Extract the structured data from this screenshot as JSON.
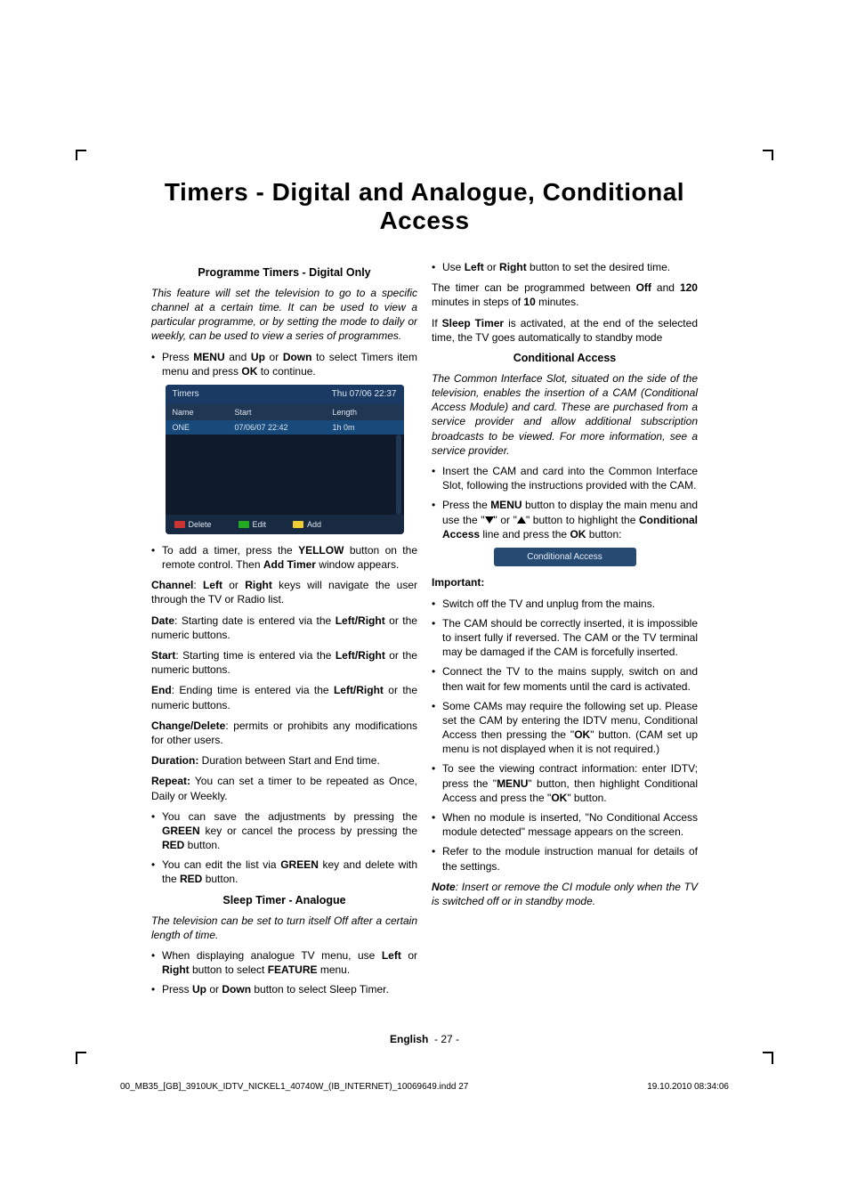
{
  "title": "Timers - Digital and Analogue, Conditional Access",
  "sections": {
    "prog_timers_head": "Programme Timers - Digital Only",
    "sleep_timer_head": "Sleep Timer - Analogue",
    "cond_access_head": "Conditional Access"
  },
  "left": {
    "intro": "This feature will set the television to go to a specific channel at a certain time. It can be used to view a particular programme, or by setting the mode to daily or weekly, can be used to view a series of programmes.",
    "li_menu_pre": "Press ",
    "li_menu_b1": "MENU",
    "li_menu_mid1": " and ",
    "li_menu_b2": "Up",
    "li_menu_mid2": " or ",
    "li_menu_b3": "Down",
    "li_menu_mid3": " to select Timers item menu and press ",
    "li_menu_b4": "OK",
    "li_menu_post": " to continue.",
    "add_pre": "To add a timer, press the ",
    "add_b1": "YELLOW",
    "add_mid": " button on the remote control. Then ",
    "add_b2": "Add Timer",
    "add_post": " window appears.",
    "channel_lbl": "Channel",
    "channel_sep": ": ",
    "channel_b1": "Left",
    "channel_mid": " or ",
    "channel_b2": "Right",
    "channel_txt": " keys will navigate the user through the TV or Radio list.",
    "date_lbl": "Date",
    "date_txt_pre": ": Starting date is entered via the ",
    "date_b": "Left/Right",
    "date_txt_post": " or the numeric buttons.",
    "start_lbl": "Start",
    "start_txt_pre": ": Starting time is entered via the ",
    "start_b": "Left/Right",
    "start_txt_post": " or the numeric buttons.",
    "end_lbl": "End",
    "end_txt_pre": ": Ending time is entered via the ",
    "end_b": "Left/Right",
    "end_txt_post": " or the numeric buttons.",
    "cd_lbl": "Change/Delete",
    "cd_txt": ": permits or prohibits any modifications for other users.",
    "dur_lbl": "Duration:",
    "dur_txt": " Duration between Start and End time.",
    "rep_lbl": "Repeat:",
    "rep_txt": " You can set a timer to be repeated as Once, Daily or Weekly.",
    "save_pre": "You can save the adjustments by pressing the ",
    "save_b1": "GREEN",
    "save_mid": " key or cancel the process by pressing the ",
    "save_b2": "RED",
    "save_post": " button.",
    "edit_pre": "You can edit the list via ",
    "edit_b1": "GREEN",
    "edit_mid": " key and delete with the ",
    "edit_b2": "RED",
    "edit_post": " button.",
    "sleep_intro": "The television can be set to turn itself Off after a certain length of time.",
    "sleep_li1_pre": "When displaying analogue TV menu, use ",
    "sleep_li1_b1": "Left",
    "sleep_li1_mid": " or ",
    "sleep_li1_b2": "Right",
    "sleep_li1_mid2": " button to select ",
    "sleep_li1_b3": "FEATURE",
    "sleep_li1_post": " menu.",
    "sleep_li2_pre": "Press ",
    "sleep_li2_b1": "Up",
    "sleep_li2_mid": " or ",
    "sleep_li2_b2": "Down",
    "sleep_li2_post": " button to select Sleep Timer."
  },
  "timers_ui": {
    "title": "Timers",
    "clock": "Thu 07/06 22:37",
    "h_name": "Name",
    "h_start": "Start",
    "h_length": "Length",
    "r_name": "ONE",
    "r_start": "07/06/07  22:42",
    "r_length": "1h 0m",
    "f_delete": "Delete",
    "f_edit": "Edit",
    "f_add": "Add"
  },
  "right": {
    "use_pre": "Use ",
    "use_b1": "Left",
    "use_mid": " or ",
    "use_b2": "Right",
    "use_post": " button to set the desired time.",
    "prog_pre": "The timer can be programmed between ",
    "prog_b1": "Off",
    "prog_mid": " and ",
    "prog_b2": "120",
    "prog_mid2": " minutes in steps of ",
    "prog_b3": "10",
    "prog_post": " minutes.",
    "ifsleep_pre": "If ",
    "ifsleep_b": "Sleep Timer",
    "ifsleep_post": " is activated, at the end of the selected time, the TV goes automatically to standby mode",
    "ca_intro": "The Common Interface Slot, situated on the side of the television, enables the insertion of a CAM (Conditional Access Module) and card. These are purchased from a service provider and allow additional subscription broadcasts to be viewed. For more information, see a service provider.",
    "ca_li1": "Insert the CAM and card into the Common Interface Slot, following the instructions provided with the CAM.",
    "ca_li2_pre": "Press the ",
    "ca_li2_b1": "MENU",
    "ca_li2_mid1": " button to display the main menu and use the \"",
    "ca_li2_mid2": "\" or \"",
    "ca_li2_mid3": "\" button to highlight the ",
    "ca_li2_b2": "Conditional Access",
    "ca_li2_mid4": " line and press the ",
    "ca_li2_b3": "OK",
    "ca_li2_post": " button:",
    "ca_bar": "Conditional Access",
    "important": "Important:",
    "imp1": "Switch off the TV and unplug from the mains.",
    "imp2": "The CAM should be correctly inserted, it is impossible to insert fully if reversed. The CAM or the TV terminal may be damaged if the CAM is forcefully inserted.",
    "imp3": "Connect the TV to the mains supply, switch on and then wait for few moments until the card is activated.",
    "imp4_pre": "Some CAMs may require the following set up. Please set the CAM by entering the IDTV menu, Conditional Access then pressing the \"",
    "imp4_b": "OK",
    "imp4_post": "\" button. (CAM set up menu is not displayed when it is not required.)",
    "imp5_pre": "To see the viewing contract information: enter IDTV; press the \"",
    "imp5_b1": "MENU",
    "imp5_mid": "\" button, then highlight Conditional Access and press the \"",
    "imp5_b2": "OK",
    "imp5_post": "\" button.",
    "imp6": "When no module is inserted, \"No Conditional Access module detected\" message appears on the screen.",
    "imp7": "Refer to the module instruction manual for details of the settings.",
    "note_lbl": "Note",
    "note_txt": ": Insert or remove the CI module only when the TV is switched off or in standby mode."
  },
  "footer": {
    "lang": "English",
    "page": "- 27 -",
    "indd": "00_MB35_[GB]_3910UK_IDTV_NICKEL1_40740W_(IB_INTERNET)_10069649.indd   27",
    "date": "19.10.2010   08:34:06"
  }
}
